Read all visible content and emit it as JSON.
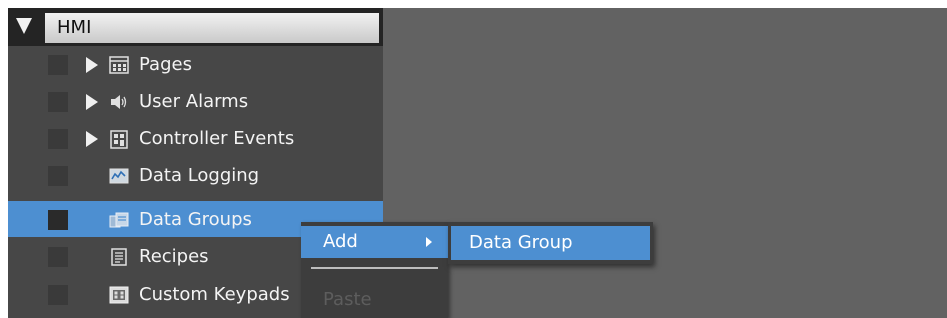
{
  "tree": {
    "root_label": "HMI",
    "items": [
      {
        "label": "Pages",
        "icon": "pages-icon",
        "expandable": true,
        "selected": false
      },
      {
        "label": "User Alarms",
        "icon": "speaker-icon",
        "expandable": true,
        "selected": false
      },
      {
        "label": "Controller Events",
        "icon": "controller-events-icon",
        "expandable": true,
        "selected": false
      },
      {
        "label": "Data Logging",
        "icon": "data-logging-icon",
        "expandable": false,
        "selected": false
      },
      {
        "label": "Data Groups",
        "icon": "data-groups-icon",
        "expandable": false,
        "selected": true
      },
      {
        "label": "Recipes",
        "icon": "recipes-icon",
        "expandable": false,
        "selected": false
      },
      {
        "label": "Custom Keypads",
        "icon": "keypad-icon",
        "expandable": false,
        "selected": false
      }
    ]
  },
  "context_menu": {
    "add_label": "Add",
    "paste_label": "Paste"
  },
  "submenu": {
    "item_label": "Data Group"
  },
  "colors": {
    "highlight": "#4d8fd1",
    "panel": "#474747",
    "background": "#626262"
  }
}
